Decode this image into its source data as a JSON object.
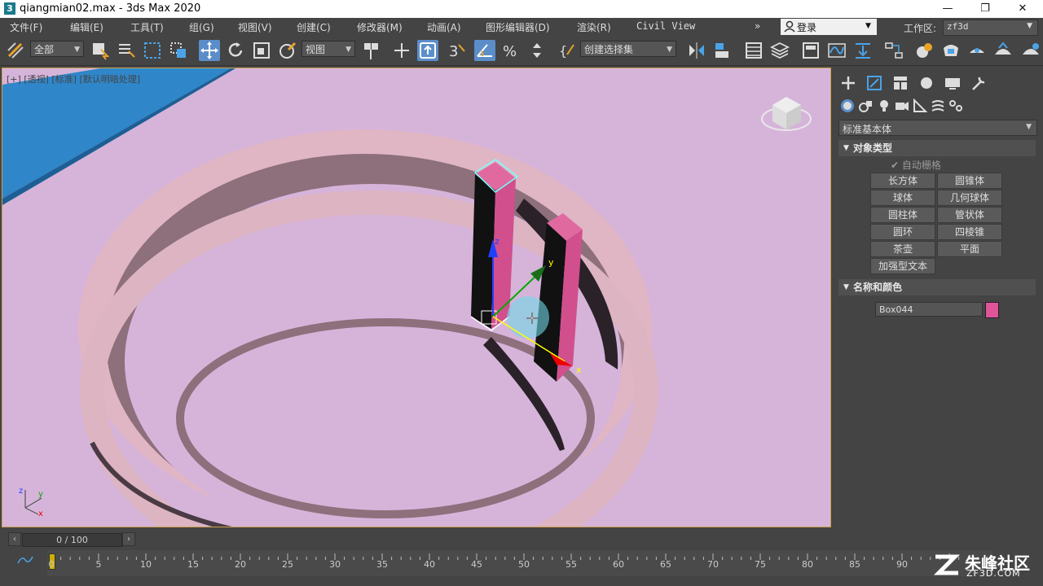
{
  "window": {
    "title": "qiangmian02.max - 3ds Max 2020",
    "controls": [
      "—",
      "❐",
      "✕"
    ]
  },
  "menubar": {
    "items": [
      "文件(F)",
      "编辑(E)",
      "工具(T)",
      "组(G)",
      "视图(V)",
      "创建(C)",
      "修改器(M)",
      "动画(A)",
      "图形编辑器(D)",
      "渲染(R)",
      "Civil View"
    ],
    "overflow": "»",
    "login": "登录",
    "workspace_label": "工作区:",
    "workspace_value": "zf3d"
  },
  "toolbar": {
    "selection_filter": "全部",
    "ref_coord": "视图",
    "named_selection": "创建选择集",
    "snap_label": "3"
  },
  "viewport": {
    "label": "[+] [透视] [标准] [默认明暗处理]",
    "gizmo_labels": {
      "x": "x",
      "y": "y",
      "z": "z"
    },
    "axis_tripod": {
      "x": "x",
      "y": "y",
      "z": "z"
    }
  },
  "command_panel": {
    "category_dropdown": "标准基本体",
    "object_type_header": "对象类型",
    "autogrid_label": "自动栅格",
    "object_buttons": [
      "长方体",
      "圆锥体",
      "球体",
      "几何球体",
      "圆柱体",
      "管状体",
      "圆环",
      "四棱锥",
      "茶壶",
      "平面",
      "加强型文本"
    ],
    "name_color_header": "名称和颜色",
    "object_name": "Box044",
    "object_color": "#e0549a"
  },
  "timeline": {
    "frame_counter": "0 / 100",
    "ticks": [
      "0",
      "5",
      "10",
      "15",
      "20",
      "25",
      "30",
      "35",
      "40",
      "45",
      "50",
      "55",
      "60",
      "65",
      "70",
      "75",
      "80",
      "85",
      "90"
    ]
  },
  "watermark": {
    "text": "朱峰社区",
    "url": "ZF3D.COM"
  }
}
